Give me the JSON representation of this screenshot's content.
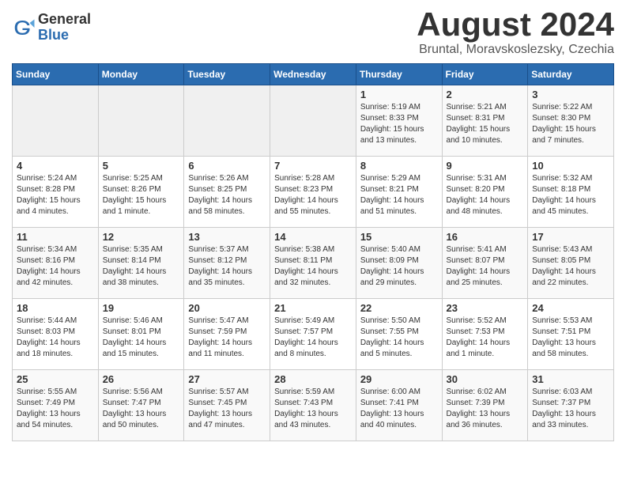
{
  "logo": {
    "general": "General",
    "blue": "Blue"
  },
  "title": {
    "month": "August 2024",
    "location": "Bruntal, Moravskoslezsky, Czechia"
  },
  "headers": [
    "Sunday",
    "Monday",
    "Tuesday",
    "Wednesday",
    "Thursday",
    "Friday",
    "Saturday"
  ],
  "weeks": [
    [
      {
        "day": "",
        "info": ""
      },
      {
        "day": "",
        "info": ""
      },
      {
        "day": "",
        "info": ""
      },
      {
        "day": "",
        "info": ""
      },
      {
        "day": "1",
        "info": "Sunrise: 5:19 AM\nSunset: 8:33 PM\nDaylight: 15 hours\nand 13 minutes."
      },
      {
        "day": "2",
        "info": "Sunrise: 5:21 AM\nSunset: 8:31 PM\nDaylight: 15 hours\nand 10 minutes."
      },
      {
        "day": "3",
        "info": "Sunrise: 5:22 AM\nSunset: 8:30 PM\nDaylight: 15 hours\nand 7 minutes."
      }
    ],
    [
      {
        "day": "4",
        "info": "Sunrise: 5:24 AM\nSunset: 8:28 PM\nDaylight: 15 hours\nand 4 minutes."
      },
      {
        "day": "5",
        "info": "Sunrise: 5:25 AM\nSunset: 8:26 PM\nDaylight: 15 hours\nand 1 minute."
      },
      {
        "day": "6",
        "info": "Sunrise: 5:26 AM\nSunset: 8:25 PM\nDaylight: 14 hours\nand 58 minutes."
      },
      {
        "day": "7",
        "info": "Sunrise: 5:28 AM\nSunset: 8:23 PM\nDaylight: 14 hours\nand 55 minutes."
      },
      {
        "day": "8",
        "info": "Sunrise: 5:29 AM\nSunset: 8:21 PM\nDaylight: 14 hours\nand 51 minutes."
      },
      {
        "day": "9",
        "info": "Sunrise: 5:31 AM\nSunset: 8:20 PM\nDaylight: 14 hours\nand 48 minutes."
      },
      {
        "day": "10",
        "info": "Sunrise: 5:32 AM\nSunset: 8:18 PM\nDaylight: 14 hours\nand 45 minutes."
      }
    ],
    [
      {
        "day": "11",
        "info": "Sunrise: 5:34 AM\nSunset: 8:16 PM\nDaylight: 14 hours\nand 42 minutes."
      },
      {
        "day": "12",
        "info": "Sunrise: 5:35 AM\nSunset: 8:14 PM\nDaylight: 14 hours\nand 38 minutes."
      },
      {
        "day": "13",
        "info": "Sunrise: 5:37 AM\nSunset: 8:12 PM\nDaylight: 14 hours\nand 35 minutes."
      },
      {
        "day": "14",
        "info": "Sunrise: 5:38 AM\nSunset: 8:11 PM\nDaylight: 14 hours\nand 32 minutes."
      },
      {
        "day": "15",
        "info": "Sunrise: 5:40 AM\nSunset: 8:09 PM\nDaylight: 14 hours\nand 29 minutes."
      },
      {
        "day": "16",
        "info": "Sunrise: 5:41 AM\nSunset: 8:07 PM\nDaylight: 14 hours\nand 25 minutes."
      },
      {
        "day": "17",
        "info": "Sunrise: 5:43 AM\nSunset: 8:05 PM\nDaylight: 14 hours\nand 22 minutes."
      }
    ],
    [
      {
        "day": "18",
        "info": "Sunrise: 5:44 AM\nSunset: 8:03 PM\nDaylight: 14 hours\nand 18 minutes."
      },
      {
        "day": "19",
        "info": "Sunrise: 5:46 AM\nSunset: 8:01 PM\nDaylight: 14 hours\nand 15 minutes."
      },
      {
        "day": "20",
        "info": "Sunrise: 5:47 AM\nSunset: 7:59 PM\nDaylight: 14 hours\nand 11 minutes."
      },
      {
        "day": "21",
        "info": "Sunrise: 5:49 AM\nSunset: 7:57 PM\nDaylight: 14 hours\nand 8 minutes."
      },
      {
        "day": "22",
        "info": "Sunrise: 5:50 AM\nSunset: 7:55 PM\nDaylight: 14 hours\nand 5 minutes."
      },
      {
        "day": "23",
        "info": "Sunrise: 5:52 AM\nSunset: 7:53 PM\nDaylight: 14 hours\nand 1 minute."
      },
      {
        "day": "24",
        "info": "Sunrise: 5:53 AM\nSunset: 7:51 PM\nDaylight: 13 hours\nand 58 minutes."
      }
    ],
    [
      {
        "day": "25",
        "info": "Sunrise: 5:55 AM\nSunset: 7:49 PM\nDaylight: 13 hours\nand 54 minutes."
      },
      {
        "day": "26",
        "info": "Sunrise: 5:56 AM\nSunset: 7:47 PM\nDaylight: 13 hours\nand 50 minutes."
      },
      {
        "day": "27",
        "info": "Sunrise: 5:57 AM\nSunset: 7:45 PM\nDaylight: 13 hours\nand 47 minutes."
      },
      {
        "day": "28",
        "info": "Sunrise: 5:59 AM\nSunset: 7:43 PM\nDaylight: 13 hours\nand 43 minutes."
      },
      {
        "day": "29",
        "info": "Sunrise: 6:00 AM\nSunset: 7:41 PM\nDaylight: 13 hours\nand 40 minutes."
      },
      {
        "day": "30",
        "info": "Sunrise: 6:02 AM\nSunset: 7:39 PM\nDaylight: 13 hours\nand 36 minutes."
      },
      {
        "day": "31",
        "info": "Sunrise: 6:03 AM\nSunset: 7:37 PM\nDaylight: 13 hours\nand 33 minutes."
      }
    ]
  ]
}
